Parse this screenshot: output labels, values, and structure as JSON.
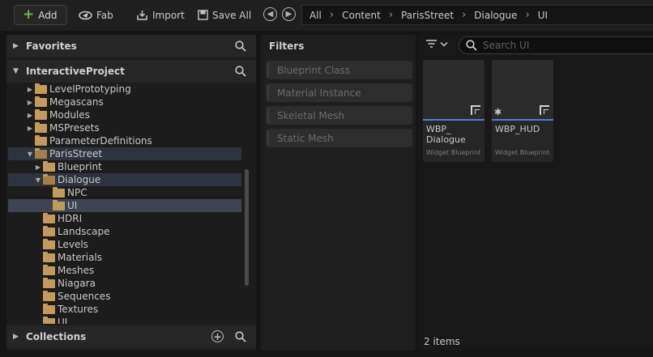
{
  "toolbar": {
    "add_label": "Add",
    "fab_label": "Fab",
    "import_label": "Import",
    "save_all_label": "Save All"
  },
  "breadcrumb": [
    "All",
    "Content",
    "ParisStreet",
    "Dialogue",
    "UI"
  ],
  "left_panel": {
    "favorites_label": "Favorites",
    "project_label": "InteractiveProject",
    "collections_label": "Collections",
    "tree": [
      {
        "label": "LevelPrototyping",
        "expander": "▶"
      },
      {
        "label": "Megascans",
        "expander": "▶"
      },
      {
        "label": "Modules",
        "expander": "▶"
      },
      {
        "label": "MSPresets",
        "expander": "▶"
      },
      {
        "label": "ParameterDefinitions",
        "expander": ""
      },
      {
        "label": "ParisStreet",
        "expander": "▼"
      },
      {
        "label": "Blueprint",
        "expander": "▶"
      },
      {
        "label": "Dialogue",
        "expander": "▼"
      },
      {
        "label": "NPC",
        "expander": ""
      },
      {
        "label": "UI",
        "expander": ""
      },
      {
        "label": "HDRI",
        "expander": ""
      },
      {
        "label": "Landscape",
        "expander": ""
      },
      {
        "label": "Levels",
        "expander": ""
      },
      {
        "label": "Materials",
        "expander": ""
      },
      {
        "label": "Meshes",
        "expander": ""
      },
      {
        "label": "Niagara",
        "expander": ""
      },
      {
        "label": "Sequences",
        "expander": ""
      },
      {
        "label": "Textures",
        "expander": ""
      },
      {
        "label": "UI",
        "expander": ""
      }
    ]
  },
  "filters": {
    "title": "Filters",
    "items": [
      "Blueprint Class",
      "Material Instance",
      "Skeletal Mesh",
      "Static Mesh"
    ]
  },
  "assets": {
    "search_placeholder": "Search UI",
    "tiles": [
      {
        "name": "WBP_ Dialogue",
        "type": "Widget Blueprint"
      },
      {
        "name": "WBP_HUD",
        "type": "Widget Blueprint"
      }
    ],
    "item_count": "2 items"
  },
  "colors": {
    "accent_blue": "#4a7fd1",
    "add_green": "#62bf39",
    "folder": "#c39a5a",
    "selection": "#3e4452"
  }
}
